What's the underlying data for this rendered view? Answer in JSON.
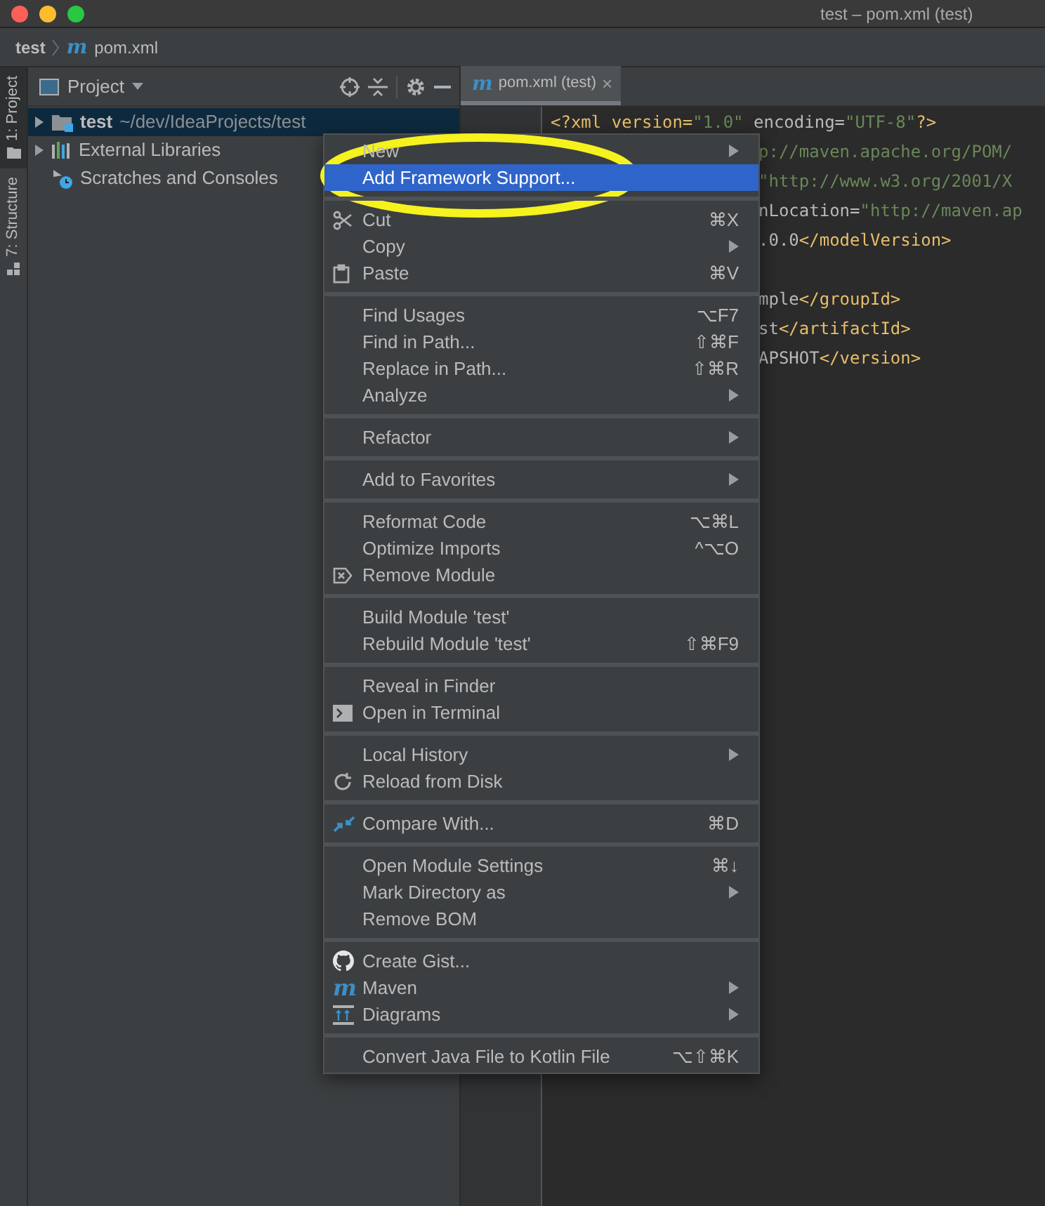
{
  "window": {
    "title": "test – pom.xml (test)"
  },
  "breadcrumb": {
    "project": "test",
    "file_icon": "m",
    "file": "pom.xml"
  },
  "tool_strip": [
    {
      "label": "1: Project",
      "selected": true
    },
    {
      "label": "7: Structure",
      "selected": false
    }
  ],
  "project_panel": {
    "title": "Project",
    "tree": [
      {
        "label": "test",
        "path": "~/dev/IdeaProjects/test",
        "expanded": false,
        "selected": true
      },
      {
        "label": "External Libraries",
        "expanded": false,
        "selected": false
      },
      {
        "label": "Scratches and Consoles",
        "selected": false
      }
    ]
  },
  "editor": {
    "tab": {
      "icon": "m",
      "label": "pom.xml (test)",
      "close": "×",
      "selected": true
    },
    "lines": [
      [
        {
          "text": "<?xml version=",
          "kind": "tag"
        },
        {
          "text": "\"1.0\"",
          "kind": "string"
        },
        {
          "text": " encoding=",
          "kind": "plain"
        },
        {
          "text": "\"UTF-8\"",
          "kind": "string"
        },
        {
          "text": "?>",
          "kind": "tag"
        }
      ],
      [
        {
          "text": "p://maven.apache.org/POM/",
          "kind": "string"
        }
      ],
      [
        {
          "text": "\"http://www.w3.org/2001/X",
          "kind": "string"
        }
      ],
      [
        {
          "text": "nLocation=",
          "kind": "plain"
        },
        {
          "text": "\"http://maven.ap",
          "kind": "string"
        }
      ],
      [
        {
          "text": ".0.0",
          "kind": "plain"
        },
        {
          "text": "</modelVersion>",
          "kind": "tag"
        }
      ],
      [
        {
          "text": "mple",
          "kind": "plain"
        },
        {
          "text": "</groupId>",
          "kind": "tag"
        }
      ],
      [
        {
          "text": "st",
          "kind": "plain"
        },
        {
          "text": "</artifactId>",
          "kind": "tag"
        }
      ],
      [
        {
          "text": "APSHOT",
          "kind": "plain"
        },
        {
          "text": "</version>",
          "kind": "tag"
        }
      ]
    ]
  },
  "context_menu": {
    "groups": [
      [
        {
          "label": "New",
          "submenu": true,
          "selected": false
        },
        {
          "label": "Add Framework Support...",
          "selected": true
        }
      ],
      [
        {
          "label": "Cut",
          "shortcut": "⌘X",
          "selected": false
        },
        {
          "label": "Copy",
          "submenu": true,
          "selected": false
        },
        {
          "label": "Paste",
          "shortcut": "⌘V",
          "selected": false
        }
      ],
      [
        {
          "label": "Find Usages",
          "shortcut": "⌥F7",
          "selected": false
        },
        {
          "label": "Find in Path...",
          "shortcut": "⇧⌘F",
          "selected": false
        },
        {
          "label": "Replace in Path...",
          "shortcut": "⇧⌘R",
          "selected": false
        },
        {
          "label": "Analyze",
          "submenu": true,
          "selected": false
        }
      ],
      [
        {
          "label": "Refactor",
          "submenu": true,
          "selected": false
        }
      ],
      [
        {
          "label": "Add to Favorites",
          "submenu": true,
          "selected": false
        }
      ],
      [
        {
          "label": "Reformat Code",
          "shortcut": "⌥⌘L",
          "selected": false
        },
        {
          "label": "Optimize Imports",
          "shortcut": "^⌥O",
          "selected": false
        },
        {
          "label": "Remove Module",
          "selected": false
        }
      ],
      [
        {
          "label": "Build Module 'test'",
          "selected": false
        },
        {
          "label": "Rebuild Module 'test'",
          "shortcut": "⇧⌘F9",
          "selected": false
        }
      ],
      [
        {
          "label": "Reveal in Finder",
          "selected": false
        },
        {
          "label": "Open in Terminal",
          "selected": false
        }
      ],
      [
        {
          "label": "Local History",
          "submenu": true,
          "selected": false
        },
        {
          "label": "Reload from Disk",
          "selected": false
        }
      ],
      [
        {
          "label": "Compare With...",
          "shortcut": "⌘D",
          "selected": false
        }
      ],
      [
        {
          "label": "Open Module Settings",
          "shortcut": "⌘↓",
          "selected": false
        },
        {
          "label": "Mark Directory as",
          "submenu": true,
          "selected": false
        },
        {
          "label": "Remove BOM",
          "selected": false
        }
      ],
      [
        {
          "label": "Create Gist...",
          "selected": false
        },
        {
          "label": "Maven",
          "icon": "m",
          "submenu": true,
          "selected": false
        },
        {
          "label": "Diagrams",
          "submenu": true,
          "selected": false
        }
      ],
      [
        {
          "label": "Convert Java File to Kotlin File",
          "shortcut": "⌥⇧⌘K",
          "selected": false
        }
      ]
    ]
  }
}
